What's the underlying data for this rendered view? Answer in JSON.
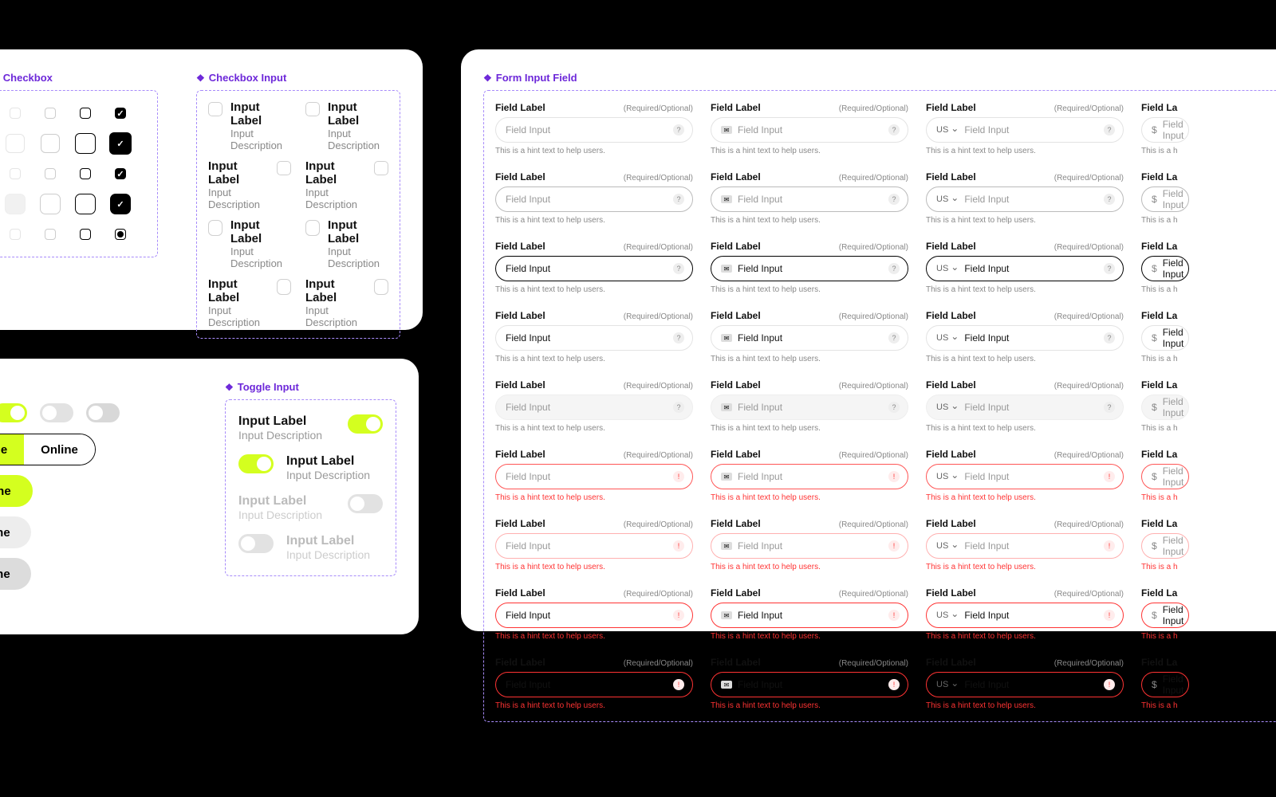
{
  "sections": {
    "checkbox": "Checkbox",
    "checkbox_input": "Checkbox Input",
    "toggle_input": "Toggle Input",
    "form_input": "Form Input Field"
  },
  "checkbox_input": {
    "label": "Input Label",
    "desc": "Input Description"
  },
  "toggle": {
    "offline": "Offline",
    "online": "Online"
  },
  "toggle_input_item": {
    "label": "Input Label",
    "desc": "Input Description"
  },
  "form": {
    "label": "Field Label",
    "req": "(Required/Optional)",
    "placeholder": "Field Input",
    "hint": "This is a hint text to help users.",
    "label_short": "Field La",
    "hint_short": "This is a h",
    "country": "US",
    "currency": "$"
  },
  "form_states": [
    "default",
    "hover",
    "focus",
    "filled",
    "disabled",
    "error",
    "err_hover",
    "err_focus",
    "err_filled"
  ],
  "state_classes": {
    "default": "",
    "hover": "s-hover",
    "focus": "s-focus",
    "filled": "s-filled",
    "disabled": "s-disabled",
    "error": "s-error",
    "err_hover": "s-err-hover s-error",
    "err_focus": "s-err-focus s-error",
    "err_filled": "s-err-filled s-error"
  }
}
